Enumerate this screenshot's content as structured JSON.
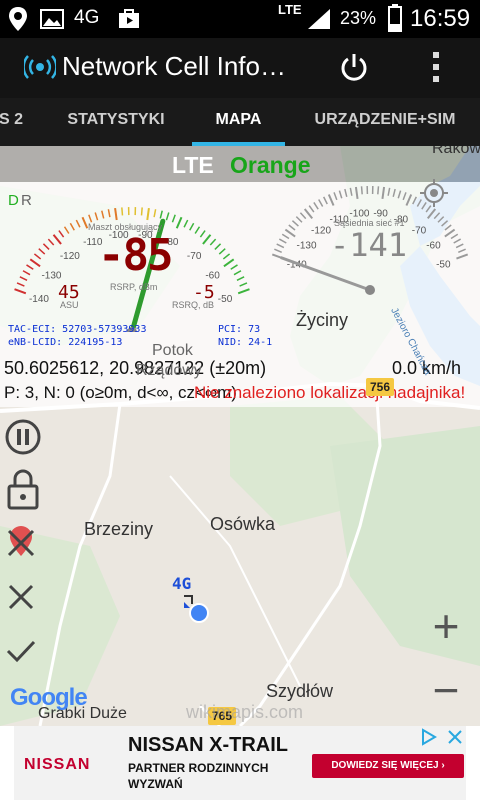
{
  "status_bar": {
    "network_type": "4G",
    "lte_indicator": "LTE",
    "battery": "23%",
    "time": "16:59"
  },
  "app": {
    "title": "Network Cell Info…"
  },
  "tabs": [
    {
      "label": "S 2"
    },
    {
      "label": "STATYSTYKI"
    },
    {
      "label": "MAPA"
    },
    {
      "label": "URZĄDZENIE+SIM"
    }
  ],
  "network": {
    "technology": "LTE",
    "operator": "Orange"
  },
  "gauges": {
    "dr": {
      "d": "D",
      "r": "R"
    },
    "serving": {
      "title": "Maszt obsługujący",
      "rsrp": "-85",
      "rsrp_label": "RSRP, dBm",
      "rsrq_label": "RSRQ, dB",
      "asu": "45",
      "asu_label": "ASU",
      "rsrq": "-5",
      "ticks": [
        "-140",
        "-130",
        "-120",
        "-110",
        "-100",
        "-90",
        "-80",
        "-70",
        "-60",
        "-50"
      ],
      "rsrp_value": -85
    },
    "neighbor": {
      "title": "Sąsiednia sieć #1",
      "rsrp": "-141",
      "ticks": [
        "-140",
        "-130",
        "-120",
        "-110",
        "-100",
        "-90",
        "-80",
        "-70",
        "-60",
        "-50"
      ],
      "rsrp_value": -141
    }
  },
  "cell_info": {
    "tac_eci": "TAC-ECI: 52703-57393933",
    "enb_lcid": "eNB-LCID: 224195-13",
    "pci": "PCI: 73",
    "nid": "NID: 24-1"
  },
  "location": {
    "coords": "50.6025612, 20.9827122 (±20m)",
    "speed": "0.0 km/h",
    "pn": "P: 3, N: 0 (o≥0m, d<∞, cz<∞m)",
    "warning": "Nie znaleziono lokalizacji nadajnika!"
  },
  "map": {
    "places": [
      "Rakow",
      "Życiny",
      "Potok",
      "Rządowy",
      "Brzeziny",
      "Osówka",
      "Szydłów",
      "Grabki Duże",
      "Jezioro Chańcza"
    ],
    "roads": [
      "756",
      "765"
    ],
    "marker_label": "4G",
    "google": "Google",
    "watermark": "wikimapis.com"
  },
  "controls": {
    "zoom_in": "+",
    "zoom_out": "−"
  },
  "ad": {
    "brand": "NISSAN",
    "title": "NISSAN X-TRAIL",
    "subtitle": "PARTNER RODZINNYCH WYZWAŃ",
    "cta": "DOWIEDZ SIĘ WIĘCEJ ›"
  },
  "colors": {
    "accent": "#33b5e5",
    "operator": "#18a51a",
    "warning": "#e02020",
    "digits": "#8b0000",
    "ad_red": "#c3002f"
  }
}
